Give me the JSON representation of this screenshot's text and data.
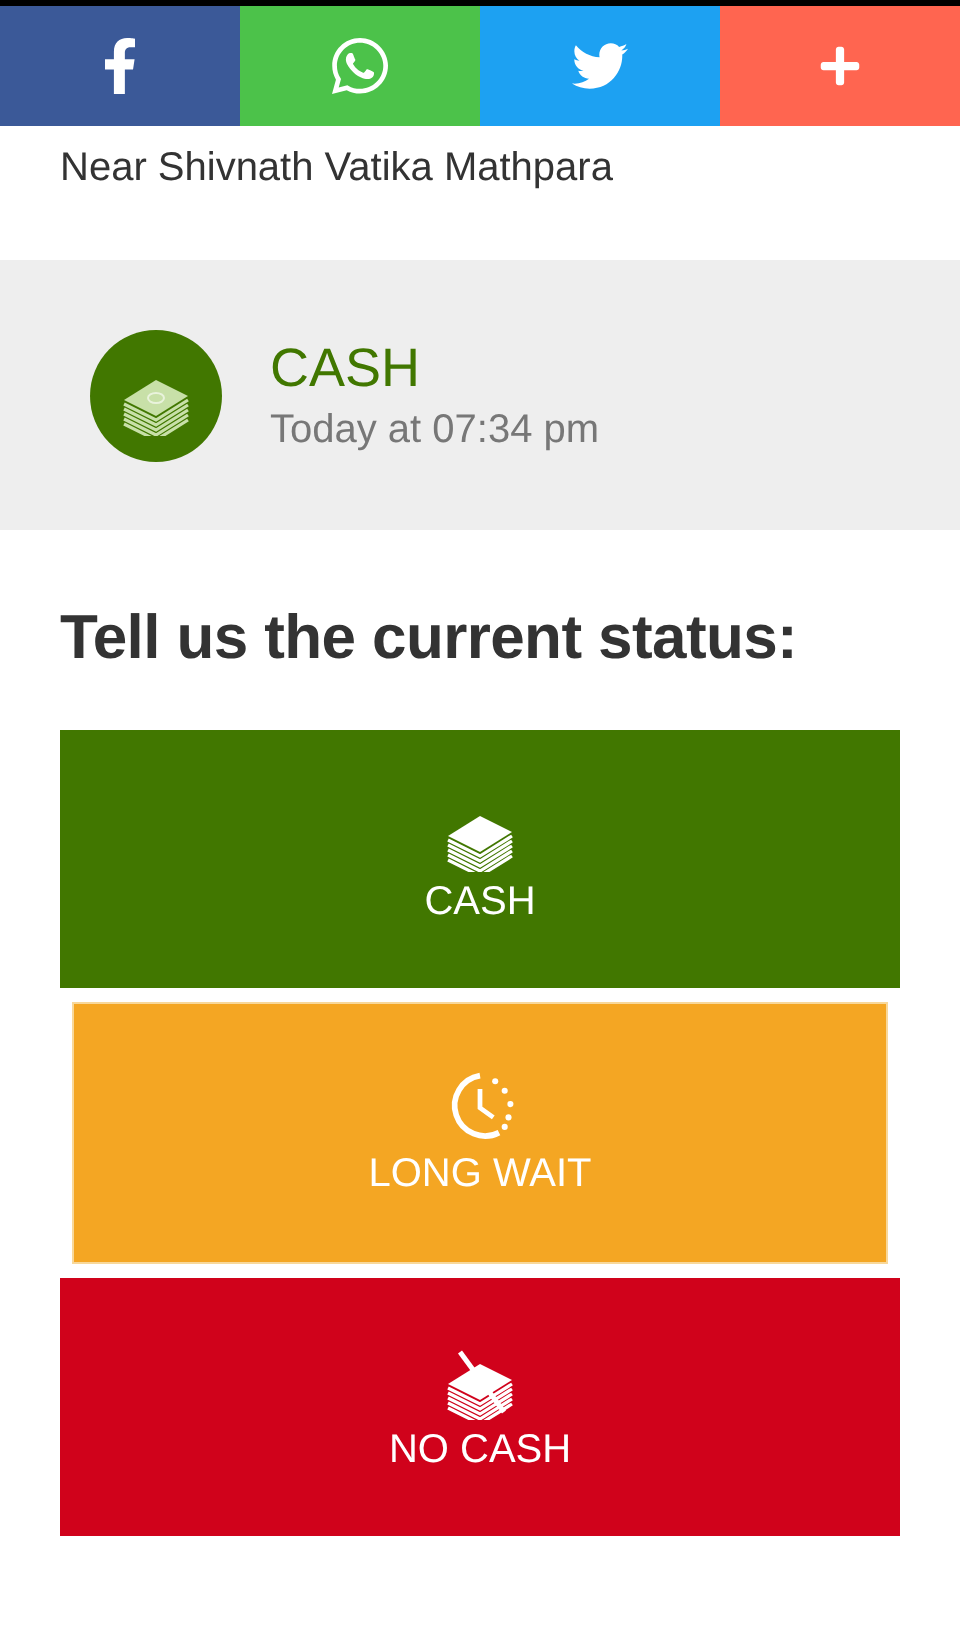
{
  "share_bar": [
    {
      "kind": "facebook",
      "color": "#3b5998"
    },
    {
      "kind": "whatsapp",
      "color": "#4cc24a"
    },
    {
      "kind": "twitter",
      "color": "#1da1f2"
    },
    {
      "kind": "more",
      "color": "#ff6550"
    }
  ],
  "address": "Near Shivnath Vatika Mathpara",
  "last_report": {
    "kind": "cash",
    "status": "CASH",
    "time": "Today at 07:34 pm"
  },
  "heading": "Tell us the current status:",
  "status_buttons": [
    {
      "kind": "cash",
      "label": "CASH",
      "color": "#417700",
      "pressed": false
    },
    {
      "kind": "wait",
      "label": "LONG WAIT",
      "color": "#f4a623",
      "pressed": true
    },
    {
      "kind": "nocash",
      "label": "NO CASH",
      "color": "#d0021b",
      "pressed": false
    }
  ]
}
